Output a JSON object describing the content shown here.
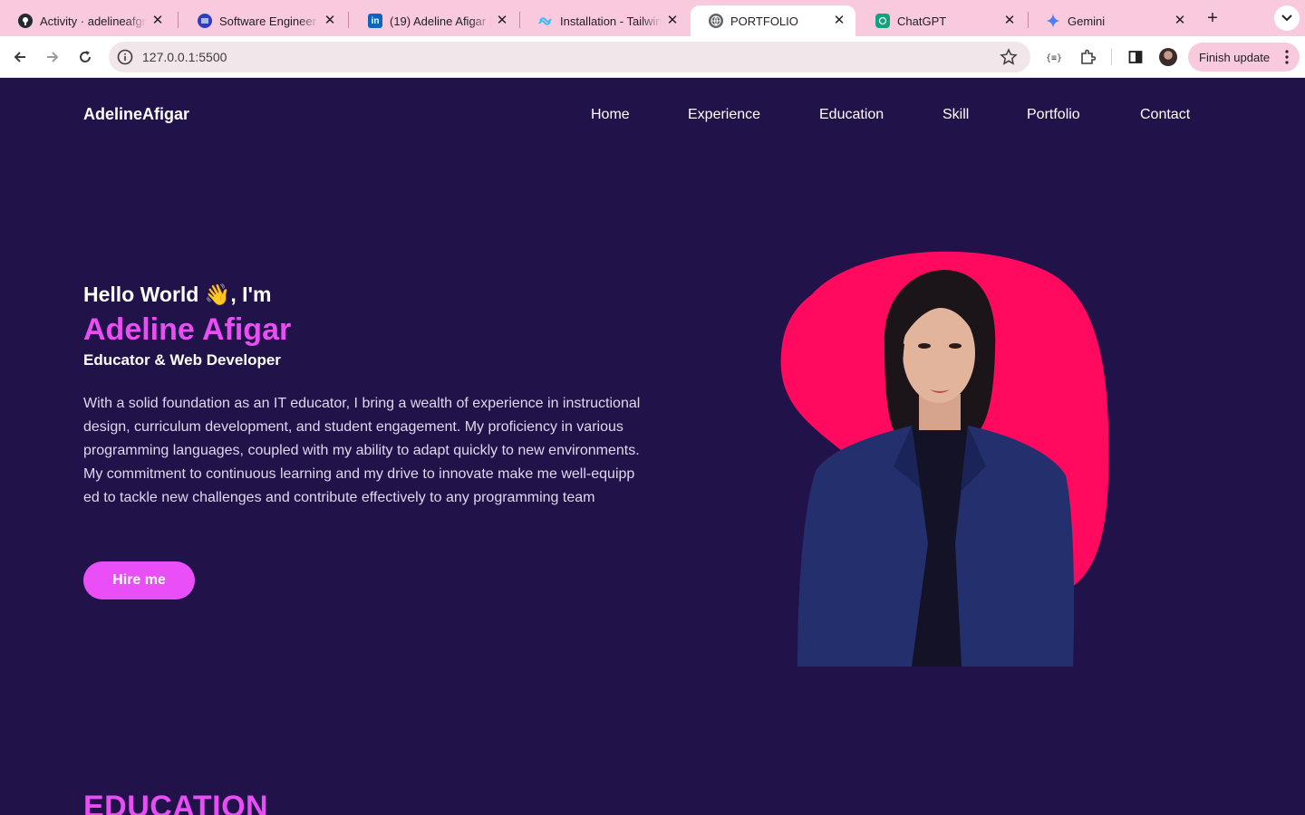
{
  "browser": {
    "tabs": [
      {
        "title": "Activity · adelineafgr",
        "icon": "github-icon",
        "color": "#24292f"
      },
      {
        "title": "Software Engineer J",
        "icon": "jobsite-icon",
        "color": "#2d3fbf"
      },
      {
        "title": "(19) Adeline Afigar |",
        "icon": "linkedin-icon",
        "color": "#0a66c2"
      },
      {
        "title": "Installation - Tailwind",
        "icon": "tailwind-icon",
        "color": "#38bdf8"
      },
      {
        "title": "PORTFOLIO",
        "icon": "globe-icon",
        "color": "#5f6368",
        "active": true
      },
      {
        "title": "ChatGPT",
        "icon": "chatgpt-icon",
        "color": "#10a37f"
      },
      {
        "title": "Gemini",
        "icon": "gemini-icon",
        "color": "#4c7df0"
      }
    ],
    "url": "127.0.0.1:5500",
    "finish_update": "Finish update"
  },
  "site": {
    "logo": "AdelineAfigar",
    "nav": [
      "Home",
      "Experience",
      "Education",
      "Skill",
      "Portfolio",
      "Contact"
    ],
    "hero": {
      "greeting": "Hello World 👋, I'm",
      "name": "Adeline Afigar",
      "role": "Educator & Web Developer",
      "description": "With a solid foundation as an IT educator, I bring a wealth of experience in instructional design, curriculum development, and student engagement. My proficiency in various programming languages, coupled with my ability to adapt quickly to new environments. My commitment to continuous learning and my drive to innovate make me well-equipp ed to tackle new challenges and contribute effectively to any programming team",
      "cta": "Hire me"
    },
    "next_section_title": "EDUCATION"
  },
  "colors": {
    "page_bg": "#22124a",
    "accent": "#e94ef5",
    "blob": "#ff0a5e",
    "tab_strip": "#f9c9dd"
  }
}
